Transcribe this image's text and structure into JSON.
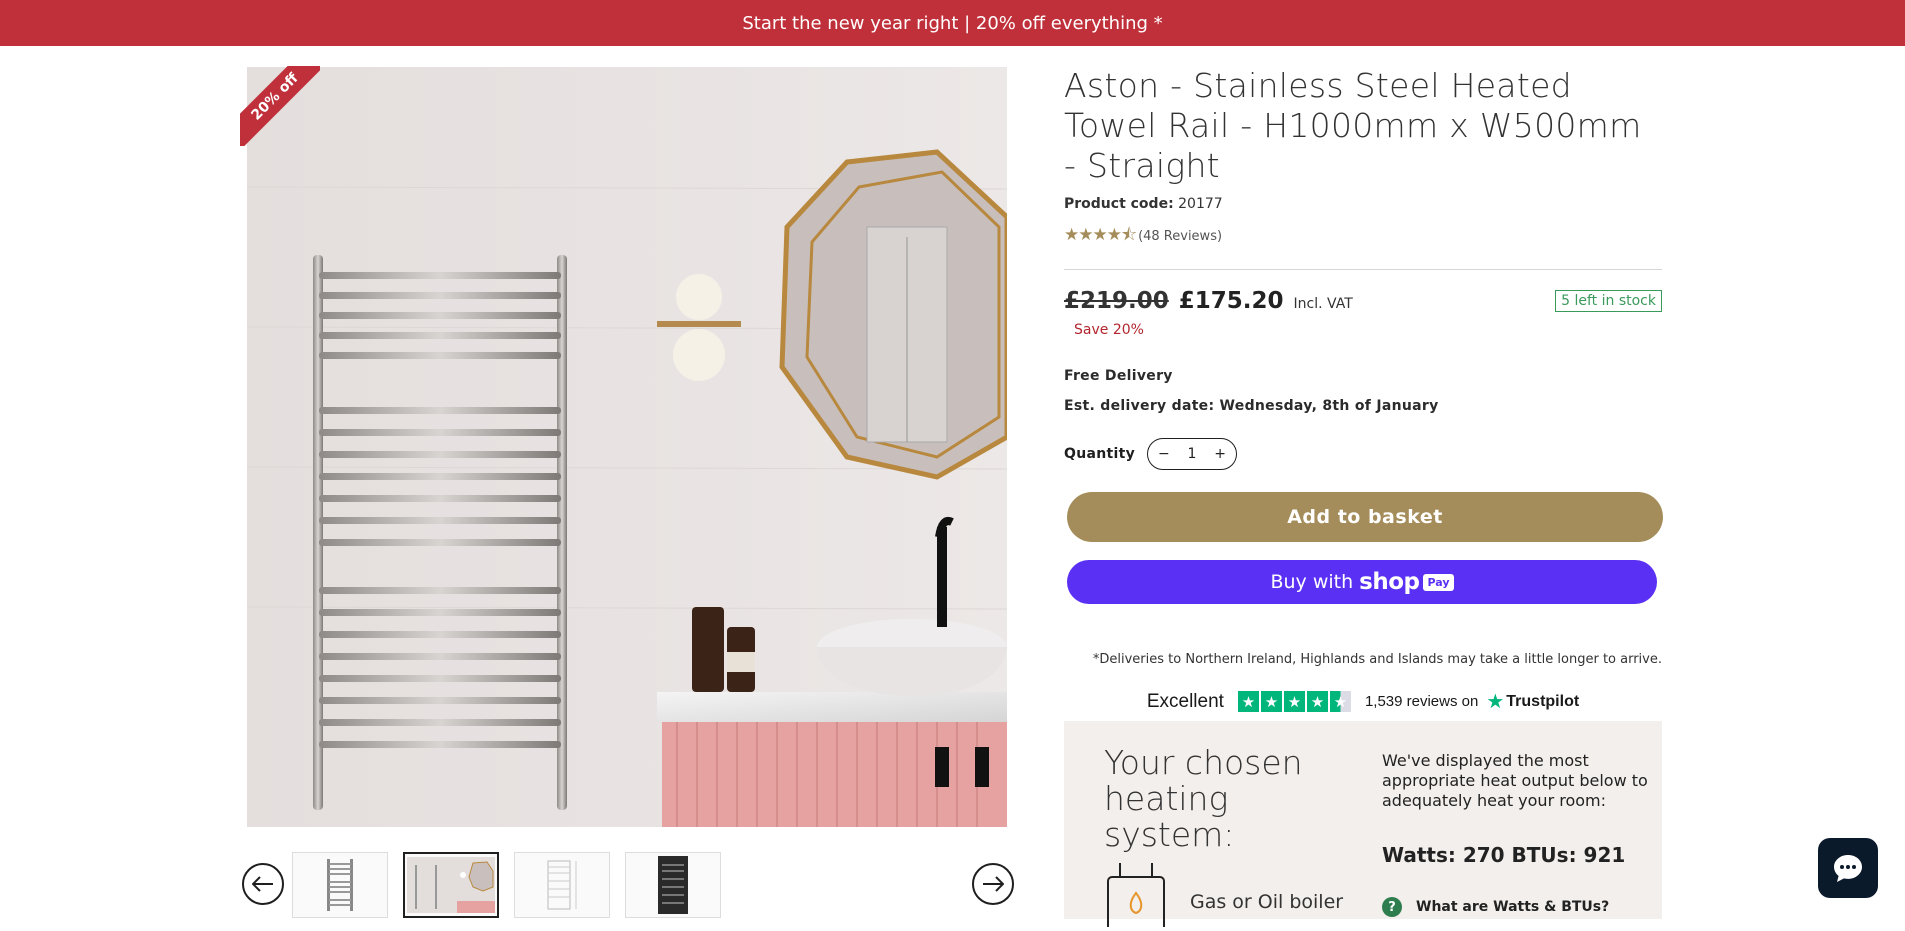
{
  "announcement": {
    "text": "Start the new year right | 20% off everything *"
  },
  "gallery": {
    "badge": "20% off"
  },
  "product": {
    "title": "Aston - Stainless Steel Heated Towel Rail - H1000mm x W500mm - Straight",
    "code_label": "Product code:",
    "code_value": "20177",
    "rating": {
      "stars": 4.5,
      "reviews_text": "(48 Reviews)"
    },
    "old_price": "£219.00",
    "price": "£175.20",
    "vat": "Incl. VAT",
    "stock": "5 left in stock",
    "save": "Save 20%",
    "delivery": "Free Delivery",
    "eta": "Est. delivery date: Wednesday, 8th of January",
    "quantity_label": "Quantity",
    "quantity_value": "1",
    "minus": "−",
    "plus": "+",
    "add_to_basket": "Add to basket",
    "buy_with": "Buy with",
    "shop_brand": "shop",
    "shop_pay": "Pay",
    "delivery_note": "*Deliveries to Northern Ireland, Highlands and Islands may take a little longer to arrive."
  },
  "trustpilot": {
    "rating_word": "Excellent",
    "reviews_text": "1,539 reviews on",
    "brand": "Trustpilot"
  },
  "heating": {
    "title": "Your chosen heating system:",
    "description": "We've displayed the most appropriate heat output below to adequately heat your room:",
    "output": "Watts: 270 BTUs: 921",
    "system": "Gas or Oil boiler",
    "help": "What are Watts & BTUs?"
  },
  "colors": {
    "banner": "#c0303a",
    "accent_gold": "#a48d5a",
    "shop_purple": "#5a31f4",
    "stock_green": "#3a9a5b",
    "trustpilot_green": "#00b67a"
  }
}
